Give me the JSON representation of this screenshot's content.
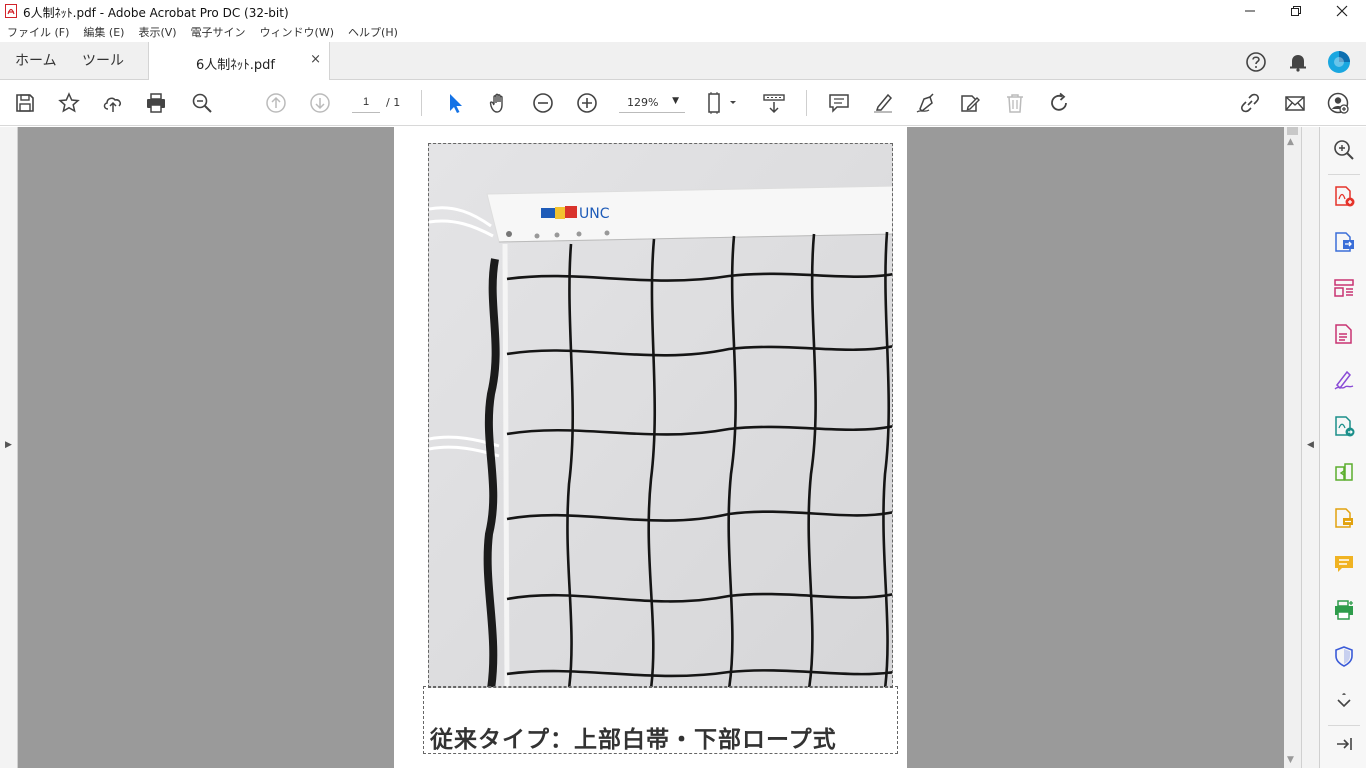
{
  "window": {
    "title": "6人制ﾈｯﾄ.pdf - Adobe Acrobat Pro DC (32-bit)",
    "minimize": "—",
    "maximize": "❐",
    "close": "✕"
  },
  "menu": [
    "ファイル (F)",
    "編集 (E)",
    "表示(V)",
    "電子サイン",
    "ウィンドウ(W)",
    "ヘルプ(H)"
  ],
  "tabs": {
    "home": "ホーム",
    "tools": "ツール",
    "document": "6人制ﾈｯﾄ.pdf",
    "close_symbol": "×"
  },
  "navigation": {
    "current_page": "1",
    "total_pages": "/ 1",
    "zoom": "129%"
  },
  "document": {
    "photo_logo": "UNC",
    "caption": "従来タイプ：上部白帯・下部ロープ式"
  },
  "colors": {
    "accent_blue": "#1473e6",
    "brand_red": "#e5332a",
    "workspace_gray": "#9a9a9a"
  }
}
